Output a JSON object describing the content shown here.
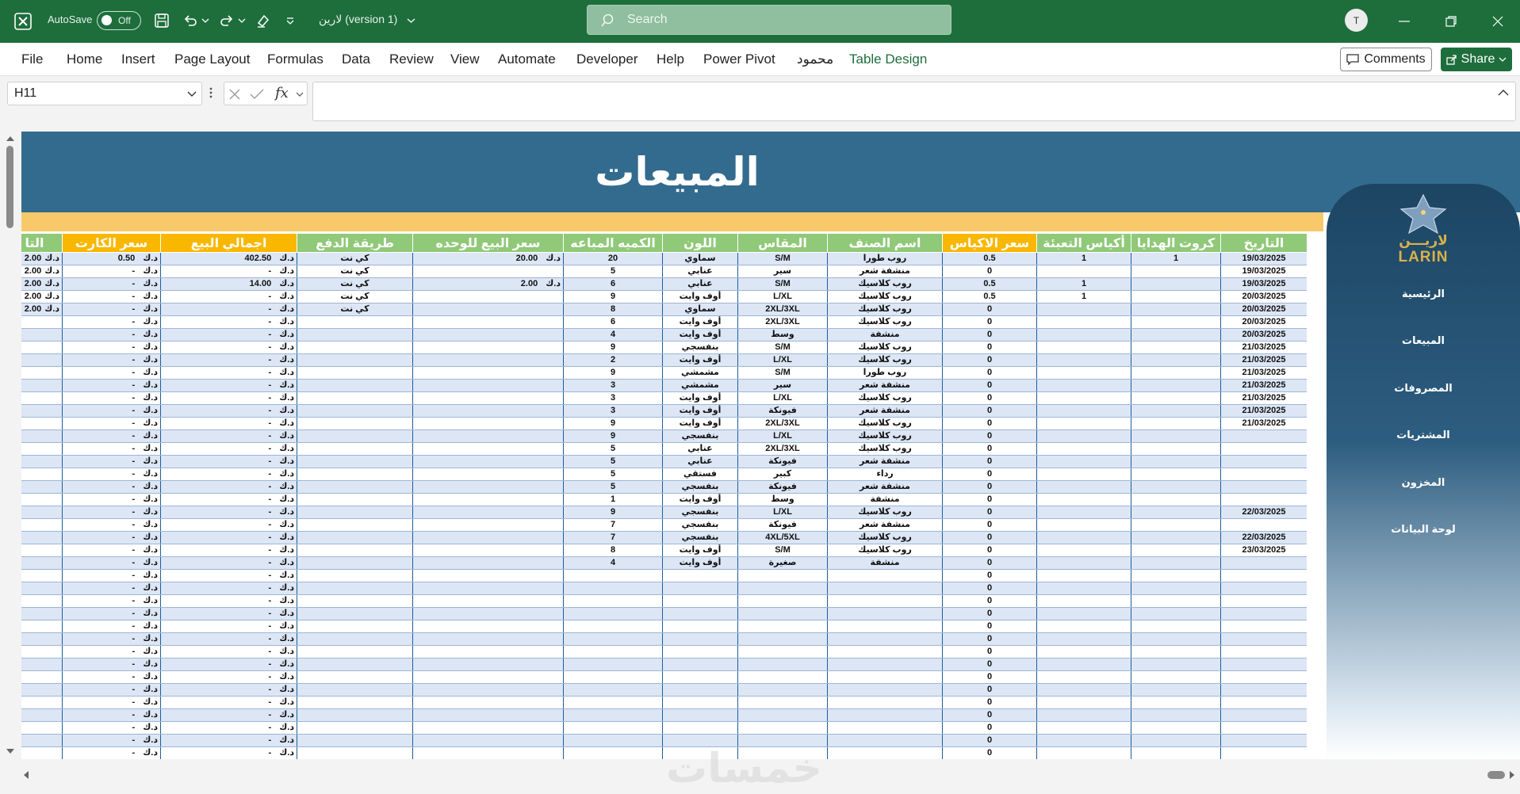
{
  "app": {
    "autosave_label": "AutoSave",
    "autosave_state": "Off",
    "doc_title": "لارين (version 1)",
    "search_placeholder": "Search",
    "user_initial": "T"
  },
  "menu": {
    "items": [
      "File",
      "Home",
      "Insert",
      "Page Layout",
      "Formulas",
      "Data",
      "Review",
      "View",
      "Automate",
      "Developer",
      "Help",
      "Power Pivot",
      "محمود",
      "Table Design"
    ],
    "comments_label": "Comments",
    "share_label": "Share"
  },
  "formula_bar": {
    "name_box": "H11",
    "fx_label": "fx",
    "formula": ""
  },
  "sheet": {
    "title": "المبيعات",
    "brand": "LARIN",
    "brand_arabic": "لاريـــن",
    "nav": [
      "الرئيسية",
      "المبيعات",
      "المصروفات",
      "المشتريات",
      "المخزون",
      "لوحة البيانات"
    ],
    "headers": [
      "التا",
      "سعر الكارت",
      "اجمالي البيع",
      "طريقة الدفع",
      "سعر البيع للوحده",
      "الكميه المباعه",
      "اللون",
      "المقاس",
      "اسم الصنف",
      "سعر الاكياس",
      "أكياس التعبئة",
      "كروت الهدايا",
      "التاريخ"
    ],
    "rows": [
      [
        "2.00",
        "0.50",
        "402.50",
        "كي نت",
        "20.00",
        "20",
        "سماوي",
        "S/M",
        "روب طورا",
        "0.5",
        "1",
        "1",
        "19/03/2025"
      ],
      [
        "2.00",
        "-",
        "-",
        "كي نت",
        "",
        "5",
        "عنابي",
        "سير",
        "منشفة شعر",
        "0",
        "",
        "",
        "19/03/2025"
      ],
      [
        "2.00",
        "-",
        "14.00",
        "كي نت",
        "2.00",
        "6",
        "عنابي",
        "S/M",
        "روب كلاسيك",
        "0.5",
        "1",
        "",
        "19/03/2025"
      ],
      [
        "2.00",
        "-",
        "-",
        "كي نت",
        "",
        "9",
        "أوف وايت",
        "L/XL",
        "روب كلاسيك",
        "0.5",
        "1",
        "",
        "20/03/2025"
      ],
      [
        "2.00",
        "-",
        "-",
        "كي نت",
        "",
        "8",
        "سماوي",
        "2XL/3XL",
        "روب كلاسيك",
        "0",
        "",
        "",
        "20/03/2025"
      ],
      [
        "",
        "-",
        "-",
        "",
        "",
        "6",
        "أوف وايت",
        "2XL/3XL",
        "روب كلاسيك",
        "0",
        "",
        "",
        "20/03/2025"
      ],
      [
        "",
        "-",
        "-",
        "",
        "",
        "4",
        "أوف وايت",
        "وسط",
        "منشفة",
        "0",
        "",
        "",
        "20/03/2025"
      ],
      [
        "",
        "-",
        "-",
        "",
        "",
        "9",
        "بنفسجي",
        "S/M",
        "روب كلاسيك",
        "0",
        "",
        "",
        "21/03/2025"
      ],
      [
        "",
        "-",
        "-",
        "",
        "",
        "2",
        "أوف وايت",
        "L/XL",
        "روب كلاسيك",
        "0",
        "",
        "",
        "21/03/2025"
      ],
      [
        "",
        "-",
        "-",
        "",
        "",
        "9",
        "مشمشي",
        "S/M",
        "روب طورا",
        "0",
        "",
        "",
        "21/03/2025"
      ],
      [
        "",
        "-",
        "-",
        "",
        "",
        "3",
        "مشمشي",
        "سير",
        "منشفة شعر",
        "0",
        "",
        "",
        "21/03/2025"
      ],
      [
        "",
        "-",
        "-",
        "",
        "",
        "3",
        "أوف وايت",
        "L/XL",
        "روب كلاسيك",
        "0",
        "",
        "",
        "21/03/2025"
      ],
      [
        "",
        "-",
        "-",
        "",
        "",
        "3",
        "أوف وايت",
        "فيونكة",
        "منشفة شعر",
        "0",
        "",
        "",
        "21/03/2025"
      ],
      [
        "",
        "-",
        "-",
        "",
        "",
        "9",
        "أوف وايت",
        "2XL/3XL",
        "روب كلاسيك",
        "0",
        "",
        "",
        "21/03/2025"
      ],
      [
        "",
        "-",
        "-",
        "",
        "",
        "9",
        "بنفسجي",
        "L/XL",
        "روب كلاسيك",
        "0",
        "",
        "",
        ""
      ],
      [
        "",
        "-",
        "-",
        "",
        "",
        "5",
        "عنابي",
        "2XL/3XL",
        "روب كلاسيك",
        "0",
        "",
        "",
        ""
      ],
      [
        "",
        "-",
        "-",
        "",
        "",
        "5",
        "عنابي",
        "فيونكة",
        "منشفة شعر",
        "0",
        "",
        "",
        ""
      ],
      [
        "",
        "-",
        "-",
        "",
        "",
        "5",
        "فستقي",
        "كبير",
        "رداء",
        "0",
        "",
        "",
        ""
      ],
      [
        "",
        "-",
        "-",
        "",
        "",
        "5",
        "بنفسجي",
        "فيونكة",
        "منشفة شعر",
        "0",
        "",
        "",
        ""
      ],
      [
        "",
        "-",
        "-",
        "",
        "",
        "1",
        "أوف وايت",
        "وسط",
        "منشفة",
        "0",
        "",
        "",
        ""
      ],
      [
        "",
        "-",
        "-",
        "",
        "",
        "9",
        "بنفسجي",
        "L/XL",
        "روب كلاسيك",
        "0",
        "",
        "",
        "22/03/2025"
      ],
      [
        "",
        "-",
        "-",
        "",
        "",
        "7",
        "بنفسجي",
        "فيونكة",
        "منشفة شعر",
        "0",
        "",
        "",
        ""
      ],
      [
        "",
        "-",
        "-",
        "",
        "",
        "7",
        "بنفسجي",
        "4XL/5XL",
        "روب كلاسيك",
        "0",
        "",
        "",
        "22/03/2025"
      ],
      [
        "",
        "-",
        "-",
        "",
        "",
        "8",
        "أوف وايت",
        "S/M",
        "روب كلاسيك",
        "0",
        "",
        "",
        "23/03/2025"
      ],
      [
        "",
        "-",
        "-",
        "",
        "",
        "4",
        "أوف وايت",
        "صغيرة",
        "منشفة",
        "0",
        "",
        "",
        ""
      ],
      [
        "",
        "-",
        "-",
        "",
        "",
        "",
        "",
        "",
        "",
        "0",
        "",
        "",
        ""
      ],
      [
        "",
        "-",
        "-",
        "",
        "",
        "",
        "",
        "",
        "",
        "0",
        "",
        "",
        ""
      ],
      [
        "",
        "-",
        "-",
        "",
        "",
        "",
        "",
        "",
        "",
        "0",
        "",
        "",
        ""
      ],
      [
        "",
        "-",
        "-",
        "",
        "",
        "",
        "",
        "",
        "",
        "0",
        "",
        "",
        ""
      ],
      [
        "",
        "-",
        "-",
        "",
        "",
        "",
        "",
        "",
        "",
        "0",
        "",
        "",
        ""
      ],
      [
        "",
        "-",
        "-",
        "",
        "",
        "",
        "",
        "",
        "",
        "0",
        "",
        "",
        ""
      ],
      [
        "",
        "-",
        "-",
        "",
        "",
        "",
        "",
        "",
        "",
        "0",
        "",
        "",
        ""
      ],
      [
        "",
        "-",
        "-",
        "",
        "",
        "",
        "",
        "",
        "",
        "0",
        "",
        "",
        ""
      ],
      [
        "",
        "-",
        "-",
        "",
        "",
        "",
        "",
        "",
        "",
        "0",
        "",
        "",
        ""
      ],
      [
        "",
        "-",
        "-",
        "",
        "",
        "",
        "",
        "",
        "",
        "0",
        "",
        "",
        ""
      ],
      [
        "",
        "-",
        "-",
        "",
        "",
        "",
        "",
        "",
        "",
        "0",
        "",
        "",
        ""
      ],
      [
        "",
        "-",
        "-",
        "",
        "",
        "",
        "",
        "",
        "",
        "0",
        "",
        "",
        ""
      ],
      [
        "",
        "-",
        "-",
        "",
        "",
        "",
        "",
        "",
        "",
        "0",
        "",
        "",
        ""
      ],
      [
        "",
        "-",
        "-",
        "",
        "",
        "",
        "",
        "",
        "",
        "0",
        "",
        "",
        ""
      ],
      [
        "",
        "-",
        "-",
        "",
        "",
        "",
        "",
        "",
        "",
        "0",
        "",
        "",
        ""
      ]
    ],
    "currency": "د.ك"
  },
  "watermark": "خمسات",
  "colors": {
    "excel_green": "#1e6e3c",
    "header_band": "#336b8e",
    "header_green": "#90c978",
    "header_yellow": "#f9b700",
    "orange_band": "#f7c96a",
    "row_blue": "#dce6f5"
  }
}
